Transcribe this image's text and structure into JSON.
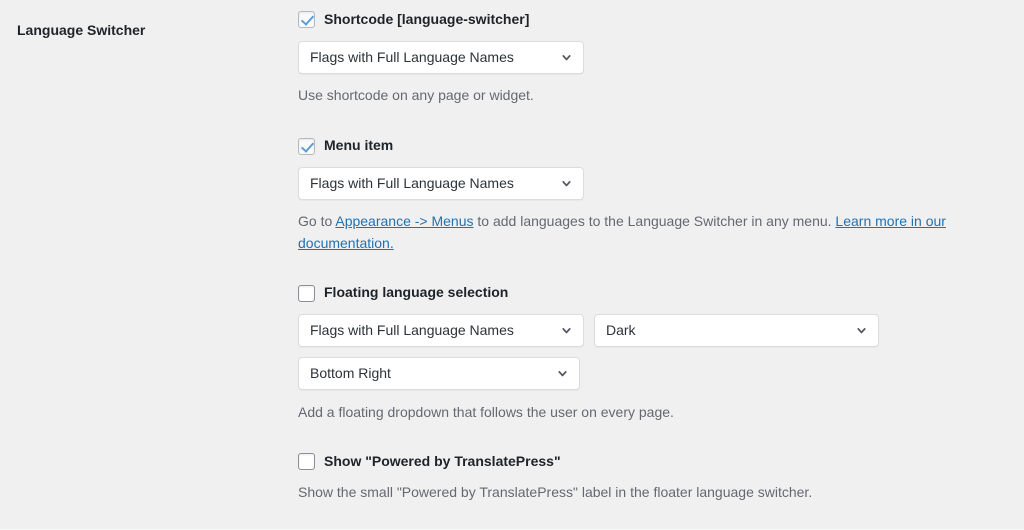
{
  "row": {
    "label": "Language Switcher"
  },
  "icons": {
    "chevron_down": "chevron-down-icon",
    "checkmark": "check-icon"
  },
  "colors": {
    "page_background": "#f0f0f1",
    "link": "#2271b1",
    "label_text": "#1d2327",
    "description_text": "#646970",
    "checkbox_check": "#5b9dd9",
    "select_border": "#dcdcde",
    "select_background": "#ffffff"
  },
  "shortcode": {
    "checkbox_label": "Shortcode [language-switcher]",
    "checked": true,
    "select_value": "Flags with Full Language Names",
    "description": "Use shortcode on any page or widget."
  },
  "menu_item": {
    "checkbox_label": "Menu item",
    "checked": true,
    "select_value": "Flags with Full Language Names",
    "description_part1": "Go to ",
    "description_link1": "Appearance -> Menus",
    "description_part2": " to add languages to the Language Switcher in any menu. ",
    "description_link2": "Learn more in our documentation."
  },
  "floating": {
    "checkbox_label": "Floating language selection",
    "checked": false,
    "select_kind_value": "Flags with Full Language Names",
    "select_theme_value": "Dark",
    "select_position_value": "Bottom Right",
    "description": "Add a floating dropdown that follows the user on every page."
  },
  "powered_by": {
    "checkbox_label": "Show \"Powered by TranslatePress\"",
    "checked": false,
    "description": "Show the small \"Powered by TranslatePress\" label in the floater language switcher."
  }
}
